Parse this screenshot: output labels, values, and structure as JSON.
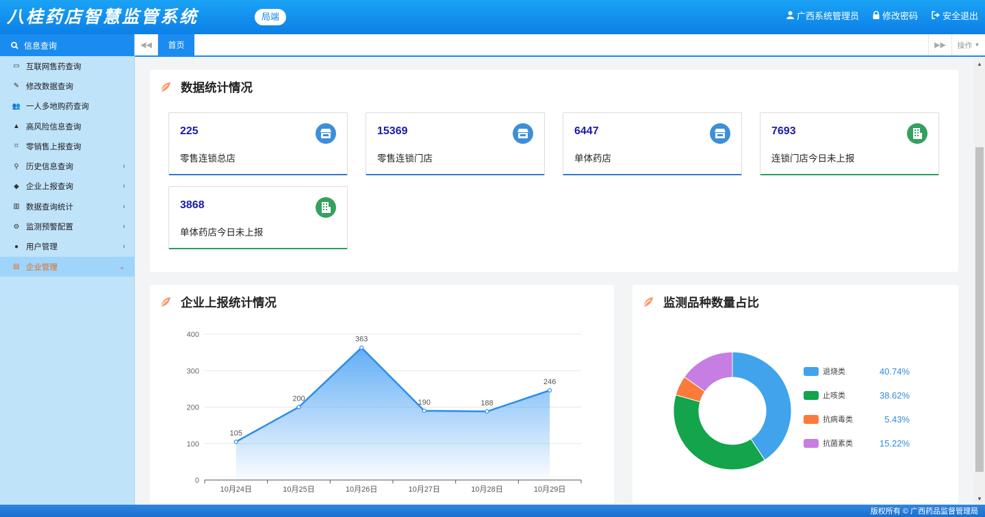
{
  "header": {
    "title": "八桂药店智慧监管系统",
    "badge": "局端",
    "user": "广西系统管理员",
    "change_password": "修改密码",
    "logout": "安全退出"
  },
  "sidebar": {
    "head": "信息查询",
    "items": [
      {
        "label": "互联网售药查询",
        "icon": "laptop-icon",
        "has_sub": false
      },
      {
        "label": "修改数据查询",
        "icon": "edit-icon",
        "has_sub": false
      },
      {
        "label": "一人多地购药查询",
        "icon": "users-icon",
        "has_sub": false
      },
      {
        "label": "高风险信息查询",
        "icon": "warning-icon",
        "has_sub": false
      },
      {
        "label": "零销售上报查询",
        "icon": "bookmark-icon",
        "has_sub": false
      },
      {
        "label": "历史信息查询",
        "icon": "search-icon",
        "has_sub": true
      },
      {
        "label": "企业上报查询",
        "icon": "tags-icon",
        "has_sub": true
      },
      {
        "label": "数据查询统计",
        "icon": "bar-chart-icon",
        "has_sub": true
      },
      {
        "label": "监测预警配置",
        "icon": "cogs-icon",
        "has_sub": true
      },
      {
        "label": "用户管理",
        "icon": "user-icon",
        "has_sub": true
      },
      {
        "label": "企业管理",
        "icon": "card-icon",
        "has_sub": true,
        "active": true
      }
    ]
  },
  "tabs": {
    "home": "首页",
    "operations": "操作"
  },
  "stats_panel": {
    "title": "数据统计情况",
    "cards": [
      {
        "value": "225",
        "label": "零售连锁总店",
        "icon": "store-icon",
        "color": "blue"
      },
      {
        "value": "15369",
        "label": "零售连锁门店",
        "icon": "store-icon",
        "color": "blue"
      },
      {
        "value": "6447",
        "label": "单体药店",
        "icon": "store-icon",
        "color": "blue"
      },
      {
        "value": "7693",
        "label": "连锁门店今日未上报",
        "icon": "building-icon",
        "color": "green"
      },
      {
        "value": "3868",
        "label": "单体药店今日未上报",
        "icon": "building-icon",
        "color": "green"
      }
    ]
  },
  "line_panel": {
    "title": "企业上报统计情况"
  },
  "pie_panel": {
    "title": "监测品种数量占比"
  },
  "chart_data": [
    {
      "type": "area",
      "title": "",
      "x": [
        "10月24日",
        "10月25日",
        "10月26日",
        "10月27日",
        "10月28日",
        "10月29日"
      ],
      "values": [
        105,
        200,
        363,
        190,
        188,
        246
      ],
      "ylim": [
        0,
        400
      ],
      "yticks": [
        0,
        100,
        200,
        300,
        400
      ],
      "grid": true,
      "color": "#2b8ce8"
    },
    {
      "type": "pie",
      "title": "",
      "donut": true,
      "legend": "right",
      "slices": [
        {
          "name": "退烧类",
          "value": 40.74,
          "label": "40.74%",
          "color": "#40a3ec"
        },
        {
          "name": "止咳类",
          "value": 38.62,
          "label": "38.62%",
          "color": "#13a44c"
        },
        {
          "name": "抗病毒类",
          "value": 5.43,
          "label": "5.43%",
          "color": "#fc7a3a"
        },
        {
          "name": "抗菌素类",
          "value": 15.22,
          "label": "15.22%",
          "color": "#c77ee2"
        }
      ]
    }
  ],
  "footer": {
    "text": "版权所有 © 广西药品监督管理局"
  }
}
